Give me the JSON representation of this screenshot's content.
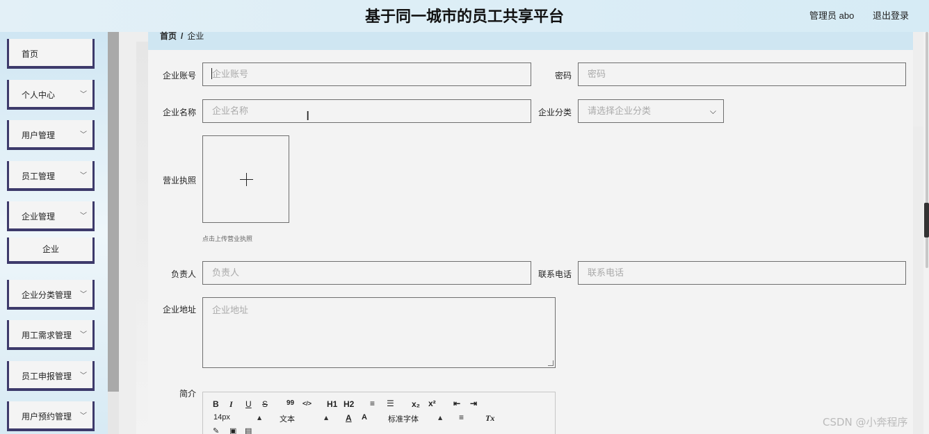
{
  "header": {
    "title": "基于同一城市的员工共享平台",
    "user": "管理员 abo",
    "logout_label": "退出登录"
  },
  "sidebar": {
    "items": [
      {
        "label": "首页",
        "has_chevron": false
      },
      {
        "label": "个人中心",
        "has_chevron": true
      },
      {
        "label": "用户管理",
        "has_chevron": true
      },
      {
        "label": "员工管理",
        "has_chevron": true
      },
      {
        "label": "企业管理",
        "has_chevron": true
      },
      {
        "label": "企业分类管理",
        "has_chevron": true
      },
      {
        "label": "用工需求管理",
        "has_chevron": true
      },
      {
        "label": "员工申报管理",
        "has_chevron": true
      },
      {
        "label": "用户预约管理",
        "has_chevron": true
      }
    ],
    "sub_item": "企业"
  },
  "breadcrumb": {
    "home": "首页",
    "separator": "/",
    "current": "企业"
  },
  "form": {
    "account": {
      "label": "企业账号",
      "placeholder": "企业账号"
    },
    "password": {
      "label": "密码",
      "placeholder": "密码"
    },
    "name": {
      "label": "企业名称",
      "placeholder": "企业名称"
    },
    "category": {
      "label": "企业分类",
      "placeholder": "请选择企业分类"
    },
    "license": {
      "label": "营业执照",
      "hint": "点击上传营业执照"
    },
    "manager": {
      "label": "负责人",
      "placeholder": "负责人"
    },
    "phone": {
      "label": "联系电话",
      "placeholder": "联系电话"
    },
    "address": {
      "label": "企业地址",
      "placeholder": "企业地址"
    },
    "intro": {
      "label": "简介"
    }
  },
  "editor": {
    "row1": [
      "B",
      "I",
      "U",
      "S",
      "99",
      "</>",
      "H1",
      "H2",
      "≡",
      "☰",
      "x₂",
      "x²",
      "⇤",
      "⇥"
    ],
    "font_size": "14px",
    "text_type": "文本",
    "font_family": "标准字体",
    "clear_format": "Tx"
  },
  "watermark": "CSDN @小奔程序"
}
